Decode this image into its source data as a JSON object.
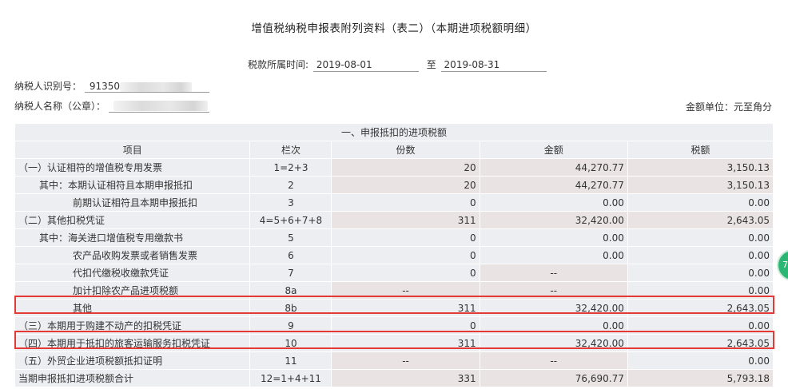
{
  "title": "增值税纳税申报表附列资料（表二）（本期进项税额明细）",
  "period": {
    "label": "税款所属时间:",
    "from": "2019-08-01",
    "to_label": "至",
    "to": "2019-08-31"
  },
  "taxpayer_id": {
    "label": "纳税人识别号：",
    "value": "91350"
  },
  "taxpayer_name": {
    "label": "纳税人名称（公章）："
  },
  "unit": "金额单位：元至角分",
  "section_title": "一、申报抵扣的进项税额",
  "headers": {
    "item": "项目",
    "col": "栏次",
    "count": "份数",
    "amount": "金额",
    "tax": "税额"
  },
  "rows": [
    {
      "item": "（一）认证相符的增值税专用发票",
      "col": "1=2+3",
      "count": "20",
      "amount": "44,270.77",
      "tax": "3,150.13"
    },
    {
      "item": "其中：本期认证相符且本期申报抵扣",
      "col": "2",
      "count": "20",
      "amount": "44,270.77",
      "tax": "3,150.13"
    },
    {
      "item": "前期认证相符且本期申报抵扣",
      "col": "3",
      "count": "0",
      "amount": "0.00",
      "tax": "0.00"
    },
    {
      "item": "（二）其他扣税凭证",
      "col": "4=5+6+7+8",
      "count": "311",
      "amount": "32,420.00",
      "tax": "2,643.05"
    },
    {
      "item": "其中：海关进口增值税专用缴款书",
      "col": "5",
      "count": "0",
      "amount": "0.00",
      "tax": "0.00"
    },
    {
      "item": "农产品收购发票或者销售发票",
      "col": "6",
      "count": "0",
      "amount": "0.00",
      "tax": "0.00"
    },
    {
      "item": "代扣代缴税收缴款凭证",
      "col": "7",
      "count": "0",
      "amount": "--",
      "tax": "0.00"
    },
    {
      "item": "加计扣除农产品进项税额",
      "col": "8a",
      "count": "--",
      "amount": "--",
      "tax": "0.00"
    },
    {
      "item": "其他",
      "col": "8b",
      "count": "311",
      "amount": "32,420.00",
      "tax": "2,643.05"
    },
    {
      "item": "（三）本期用于购建不动产的扣税凭证",
      "col": "9",
      "count": "0",
      "amount": "0.00",
      "tax": "0.00"
    },
    {
      "item": "（四）本期用于抵扣的旅客运输服务扣税凭证",
      "col": "10",
      "count": "311",
      "amount": "32,420.00",
      "tax": "2,643.05"
    },
    {
      "item": "（五）外贸企业进项税额抵扣证明",
      "col": "11",
      "count": "--",
      "amount": "--",
      "tax": "0.00"
    },
    {
      "item": "当期申报抵扣进项税额合计",
      "col": "12=1+4+11",
      "count": "331",
      "amount": "76,690.77",
      "tax": "5,793.18"
    }
  ],
  "colors": {
    "highlight": "#e53935",
    "cell_light": "#eceef1",
    "cell_gray": "#e9e3e3",
    "fab": "#2bb673"
  }
}
